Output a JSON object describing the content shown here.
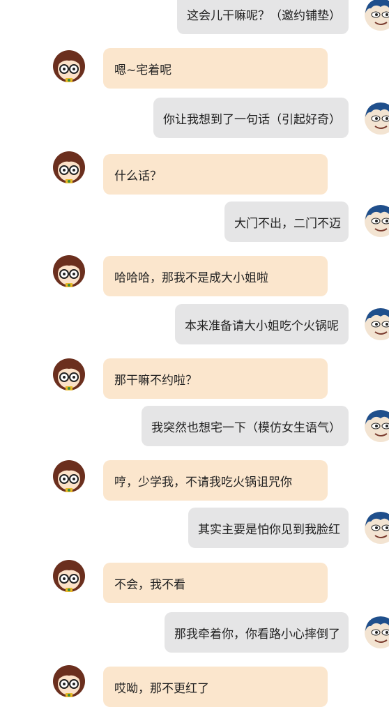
{
  "messages": [
    {
      "from": "me",
      "text": "这会儿干嘛呢？（邀约铺垫）"
    },
    {
      "from": "her",
      "text": "嗯~宅着呢"
    },
    {
      "from": "me",
      "text": "你让我想到了一句话（引起好奇）"
    },
    {
      "from": "her",
      "text": "什么话？"
    },
    {
      "from": "me",
      "text": "大门不出，二门不迈"
    },
    {
      "from": "her",
      "text": "哈哈哈，那我不是成大小姐啦"
    },
    {
      "from": "me",
      "text": "本来准备请大小姐吃个火锅呢"
    },
    {
      "from": "her",
      "text": "那干嘛不约啦？"
    },
    {
      "from": "me",
      "text": "我突然也想宅一下（模仿女生语气）"
    },
    {
      "from": "her",
      "text": "哼，少学我，不请我吃火锅诅咒你"
    },
    {
      "from": "me",
      "text": "其实主要是怕你见到我脸红"
    },
    {
      "from": "her",
      "text": "不会，我不看"
    },
    {
      "from": "me",
      "text": "那我牵着你，你看路小心摔倒了"
    },
    {
      "from": "her",
      "text": "哎呦，那不更红了"
    }
  ],
  "avatars": {
    "her": "girl-glasses-avatar",
    "me": "boy-cartoon-avatar"
  },
  "colors": {
    "received_bubble": "#fbe6cd",
    "sent_bubble": "#e5e5e6",
    "background": "#ffffff"
  }
}
